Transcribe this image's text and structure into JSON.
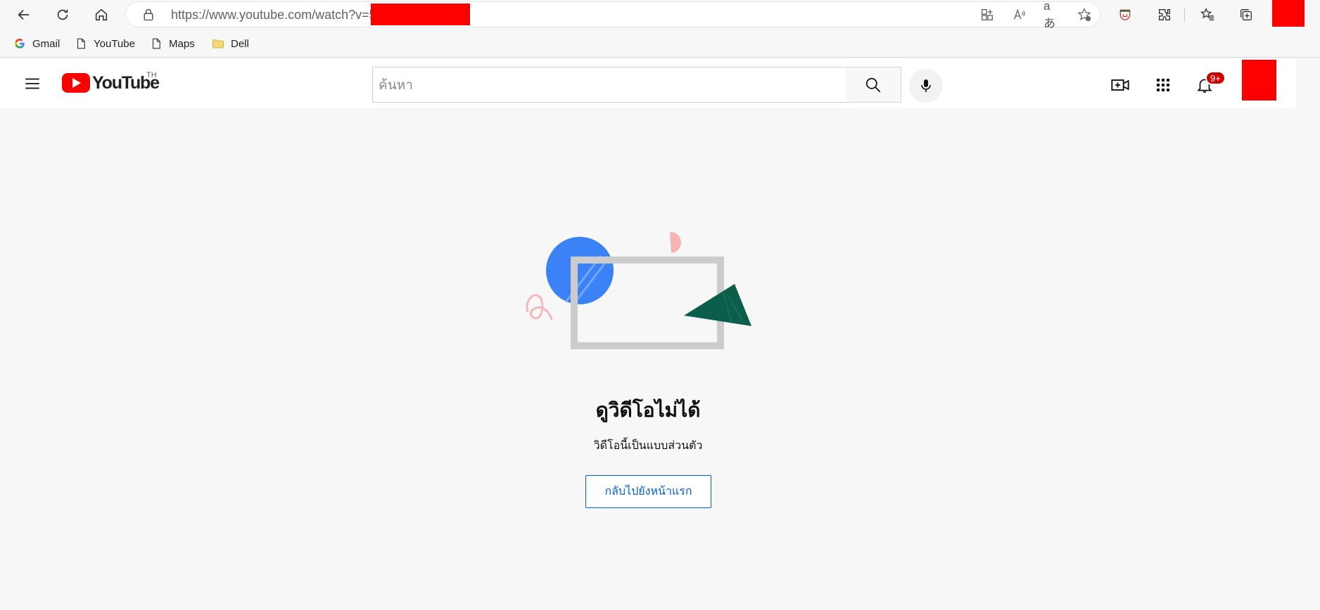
{
  "browser": {
    "url": "https://www.youtube.com/watch?v=5",
    "bookmarks": [
      {
        "label": "Gmail",
        "icon": "google-icon"
      },
      {
        "label": "YouTube",
        "icon": "page-icon"
      },
      {
        "label": "Maps",
        "icon": "page-icon"
      },
      {
        "label": "Dell",
        "icon": "folder-icon"
      }
    ]
  },
  "youtube": {
    "logo_text": "YouTube",
    "country_code": "TH",
    "search_placeholder": "ค้นหา",
    "notification_badge": "9+",
    "accent_color": "#ff0000"
  },
  "error": {
    "title": "ดูวิดีโอไม่ได้",
    "message": "วิดีโอนี้เป็นแบบส่วนตัว",
    "home_button": "กลับไปยังหน้าแรก"
  }
}
